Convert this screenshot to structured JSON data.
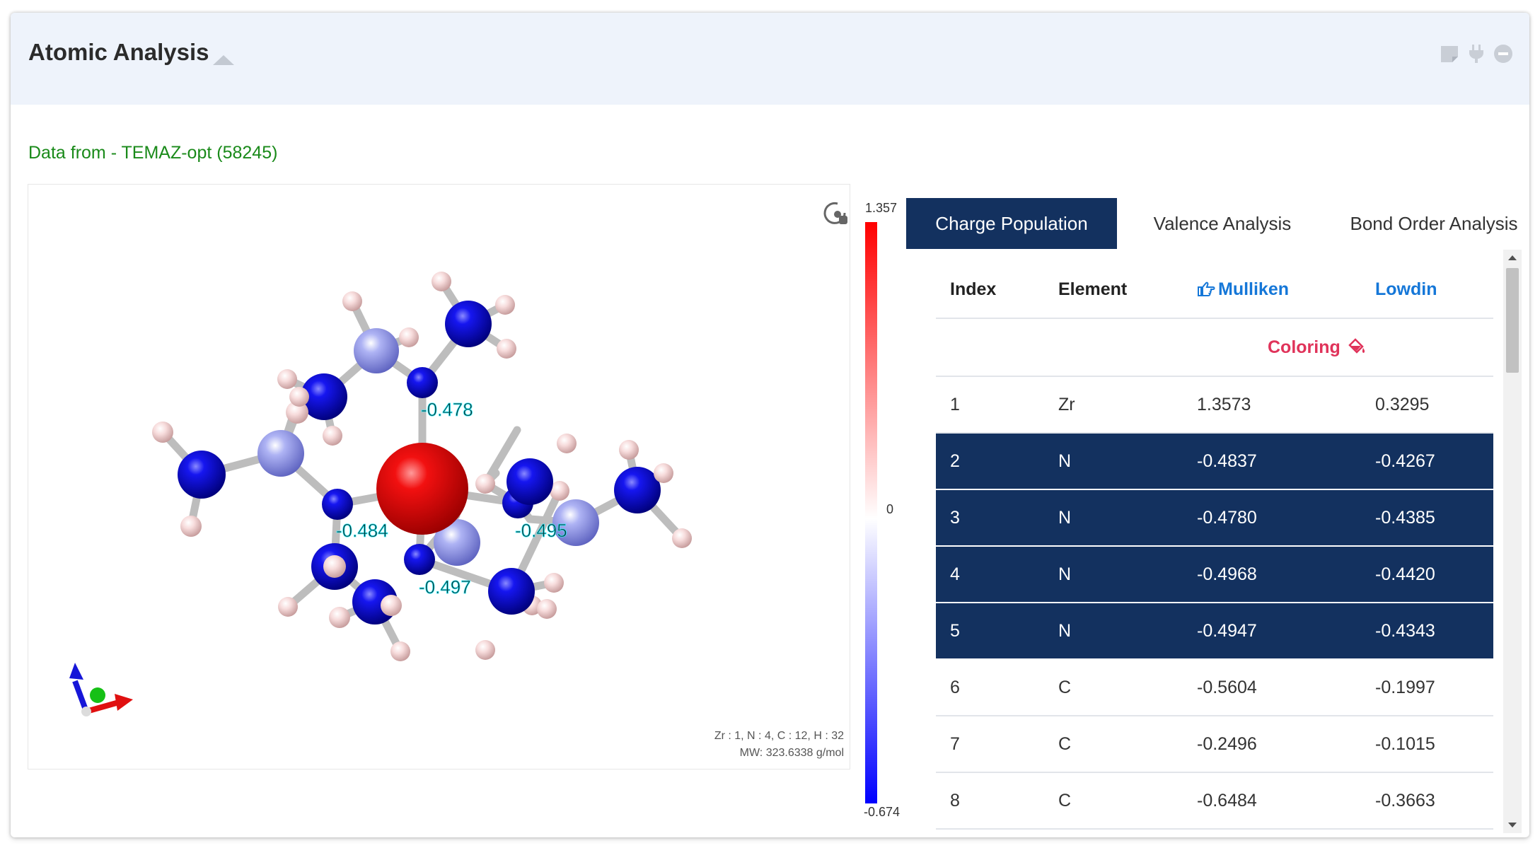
{
  "header": {
    "title": "Atomic Analysis",
    "icons": [
      "sticky-note-icon",
      "plug-icon",
      "minus-circle-icon"
    ]
  },
  "data_source": "Data from - TEMAZ-opt (58245)",
  "viewer": {
    "atom_labels": [
      "-0.478",
      "-0.484",
      "-0.495",
      "-0.497"
    ],
    "formula": "Zr : 1, N : 4, C : 12, H : 32",
    "mw": "MW: 323.6338 g/mol"
  },
  "colorbar": {
    "max": "1.357",
    "mid": "0",
    "min": "-0.674",
    "colors": {
      "high": "#ff0000",
      "mid": "#ffffff",
      "low": "#0000ff"
    }
  },
  "tabs": [
    {
      "label": "Charge Population",
      "active": true
    },
    {
      "label": "Valence Analysis",
      "active": false
    },
    {
      "label": "Bond Order Analysis",
      "active": false
    }
  ],
  "table": {
    "headers": [
      "Index",
      "Element",
      "Mulliken",
      "Lowdin"
    ],
    "coloring_label": "Coloring",
    "rows": [
      {
        "index": "1",
        "element": "Zr",
        "mulliken": "1.3573",
        "lowdin": "0.3295",
        "selected": false
      },
      {
        "index": "2",
        "element": "N",
        "mulliken": "-0.4837",
        "lowdin": "-0.4267",
        "selected": true
      },
      {
        "index": "3",
        "element": "N",
        "mulliken": "-0.4780",
        "lowdin": "-0.4385",
        "selected": true
      },
      {
        "index": "4",
        "element": "N",
        "mulliken": "-0.4968",
        "lowdin": "-0.4420",
        "selected": true
      },
      {
        "index": "5",
        "element": "N",
        "mulliken": "-0.4947",
        "lowdin": "-0.4343",
        "selected": true
      },
      {
        "index": "6",
        "element": "C",
        "mulliken": "-0.5604",
        "lowdin": "-0.1997",
        "selected": false
      },
      {
        "index": "7",
        "element": "C",
        "mulliken": "-0.2496",
        "lowdin": "-0.1015",
        "selected": false
      },
      {
        "index": "8",
        "element": "C",
        "mulliken": "-0.6484",
        "lowdin": "-0.3663",
        "selected": false
      }
    ]
  },
  "colors": {
    "brand_navy": "#13315f",
    "link_blue": "#1577d8",
    "coloring_red": "#e0335a",
    "source_green": "#1a8a1a"
  }
}
